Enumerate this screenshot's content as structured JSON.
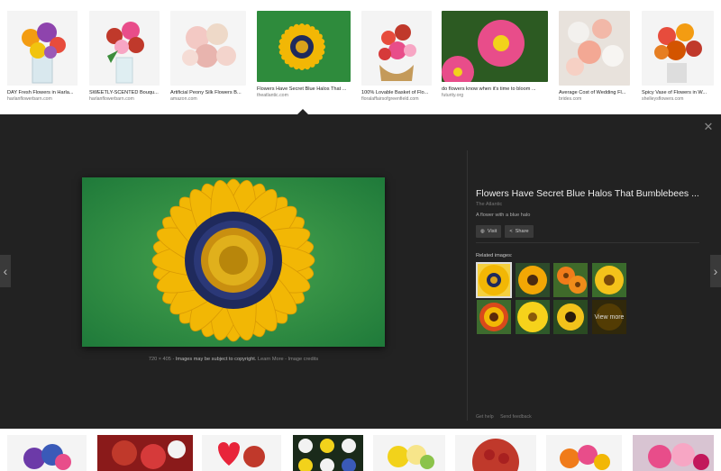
{
  "results_top": [
    {
      "caption": "DAY Fresh Flowers in Harla...",
      "source": "harlanflowerbarn.com"
    },
    {
      "caption": "SWEETLY-SCENTED Bouqu...",
      "source": "harlanflowerbarn.com"
    },
    {
      "caption": "Artificial Peony Silk Flowers B...",
      "source": "amazon.com"
    },
    {
      "caption": "Flowers Have Secret Blue Halos That ...",
      "source": "theatlantic.com"
    },
    {
      "caption": "100% Lovable Basket of Flo...",
      "source": "floralaffairsofgreenfield.com"
    },
    {
      "caption": "do flowers know when it's time to bloom ...",
      "source": "futurity.org"
    },
    {
      "caption": "Average Cost of Wedding Fl...",
      "source": "brides.com"
    },
    {
      "caption": "Spicy Vase of Flowers in W...",
      "source": "shelleysflowers.com"
    }
  ],
  "preview": {
    "title": "Flowers Have Secret Blue Halos That Bumblebees ...",
    "site": "The Atlantic",
    "description": "A flower with a blue halo",
    "visit_label": "Visit",
    "share_label": "Share",
    "dimensions": "720 × 405",
    "copyright": "Images may be subject to copyright.",
    "learn_more": "Learn More",
    "image_credits": "Image credits",
    "related_label": "Related images:",
    "view_more": "View more",
    "get_help": "Get help",
    "send_feedback": "Send feedback"
  },
  "icons": {
    "close": "close-icon",
    "prev": "chevron-left-icon",
    "next": "chevron-right-icon",
    "visit": "globe-icon",
    "share": "share-icon"
  },
  "colors": {
    "panel_bg": "#222222",
    "flower_yellow": "#f2b705",
    "flower_center": "#1f2a5c",
    "leaf_green": "#2f8a3e"
  }
}
